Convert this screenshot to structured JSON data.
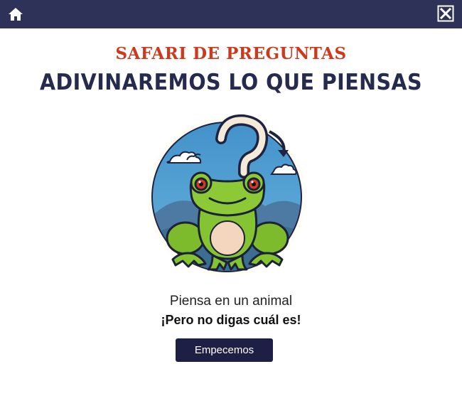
{
  "topbar": {
    "home_icon": "home-icon",
    "close_icon": "close-icon",
    "background": "#2e3258"
  },
  "header": {
    "subtitle": "SAFARI DE PREGUNTAS",
    "title": "ADIVINAREMOS LO QUE PIENSAS"
  },
  "illustration": {
    "subject": "frog-with-question-mark-illustration"
  },
  "prompt": {
    "line1": "Piensa en un animal",
    "line2": "¡Pero no digas cuál es!"
  },
  "start_button": {
    "label": "Empecemos"
  },
  "colors": {
    "title_red": "#cc3a1e",
    "title_navy": "#252a4e",
    "button": "#1e1f45"
  }
}
